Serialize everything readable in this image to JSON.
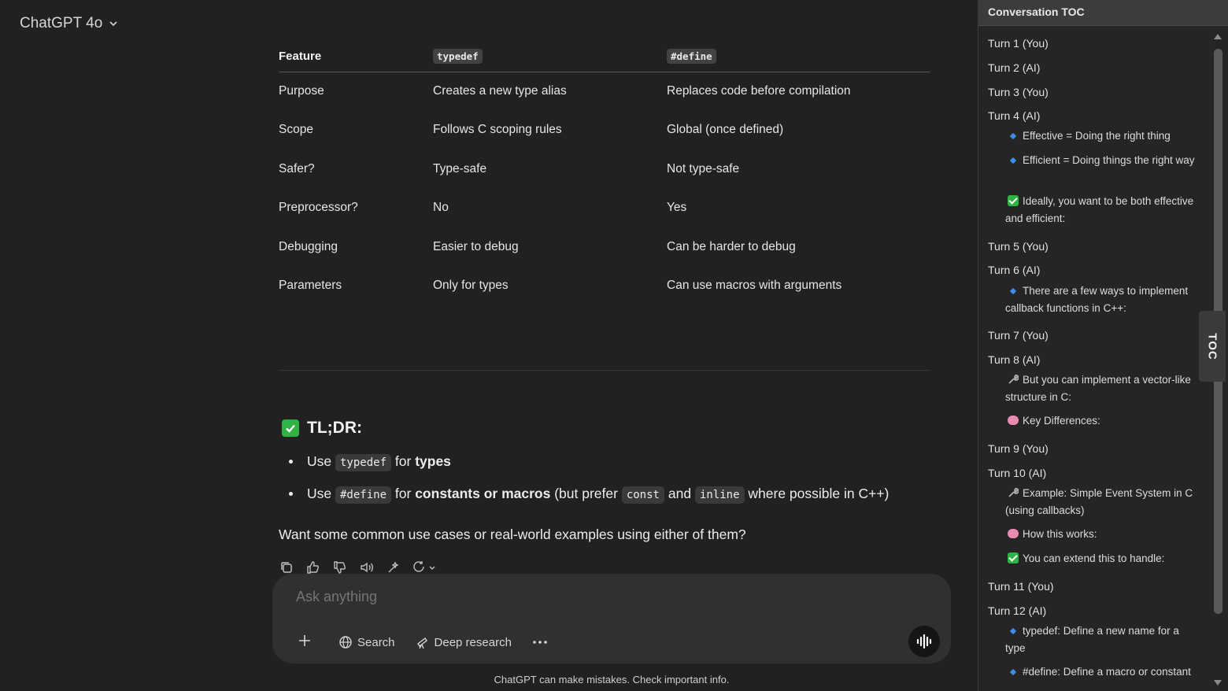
{
  "header": {
    "model_label": "ChatGPT 4o"
  },
  "table": {
    "headers": [
      "Feature",
      "typedef",
      "#define"
    ],
    "rows": [
      [
        "Purpose",
        "Creates a new type alias",
        "Replaces code before compilation"
      ],
      [
        "Scope",
        "Follows C scoping rules",
        "Global (once defined)"
      ],
      [
        "Safer?",
        "Type-safe",
        "Not type-safe"
      ],
      [
        "Preprocessor?",
        "No",
        "Yes"
      ],
      [
        "Debugging",
        "Easier to debug",
        "Can be harder to debug"
      ],
      [
        "Parameters",
        "Only for types",
        "Can use macros with arguments"
      ]
    ]
  },
  "tldr": {
    "heading": "TL;DR:",
    "bullet1": {
      "pre": "Use",
      "code": "typedef",
      "mid": "for",
      "bold": "types"
    },
    "bullet2": {
      "pre": "Use",
      "code1": "#define",
      "mid": "for",
      "bold": "constants or macros",
      "post1": "(but prefer",
      "code2": "const",
      "and": "and",
      "code3": "inline",
      "post2": "where possible in C++)"
    }
  },
  "question": "Want some common use cases or real-world examples using either of them?",
  "composer": {
    "placeholder": "Ask anything",
    "search_label": "Search",
    "deep_research_label": "Deep research"
  },
  "footer_note": "ChatGPT can make mistakes. Check important info.",
  "toc": {
    "title": "Conversation TOC",
    "tab_label": "TOC",
    "turns": [
      "Turn 1 (You)",
      "Turn 2 (AI)",
      "Turn 3 (You)",
      "Turn 4 (AI)",
      "Turn 5 (You)",
      "Turn 6 (AI)",
      "Turn 7 (You)",
      "Turn 8 (AI)",
      "Turn 9 (You)",
      "Turn 10 (AI)",
      "Turn 11 (You)",
      "Turn 12 (AI)"
    ],
    "subs": [
      "Effective = Doing the right thing",
      "Efficient = Doing things the right way",
      "Ideally, you want to be both effective and efficient:",
      "There are a few ways to implement callback functions in C++:",
      "But you can implement a vector-like structure in C:",
      "Key Differences:",
      "Example: Simple Event System in C (using callbacks)",
      "How this works:",
      "You can extend this to handle:",
      "typedef: Define a new name for a type",
      "#define: Define a macro or constant"
    ]
  },
  "colors": {
    "background": "#212121",
    "composer": "#303030",
    "accent_green": "#2fb344",
    "toc_bg": "#252526"
  }
}
